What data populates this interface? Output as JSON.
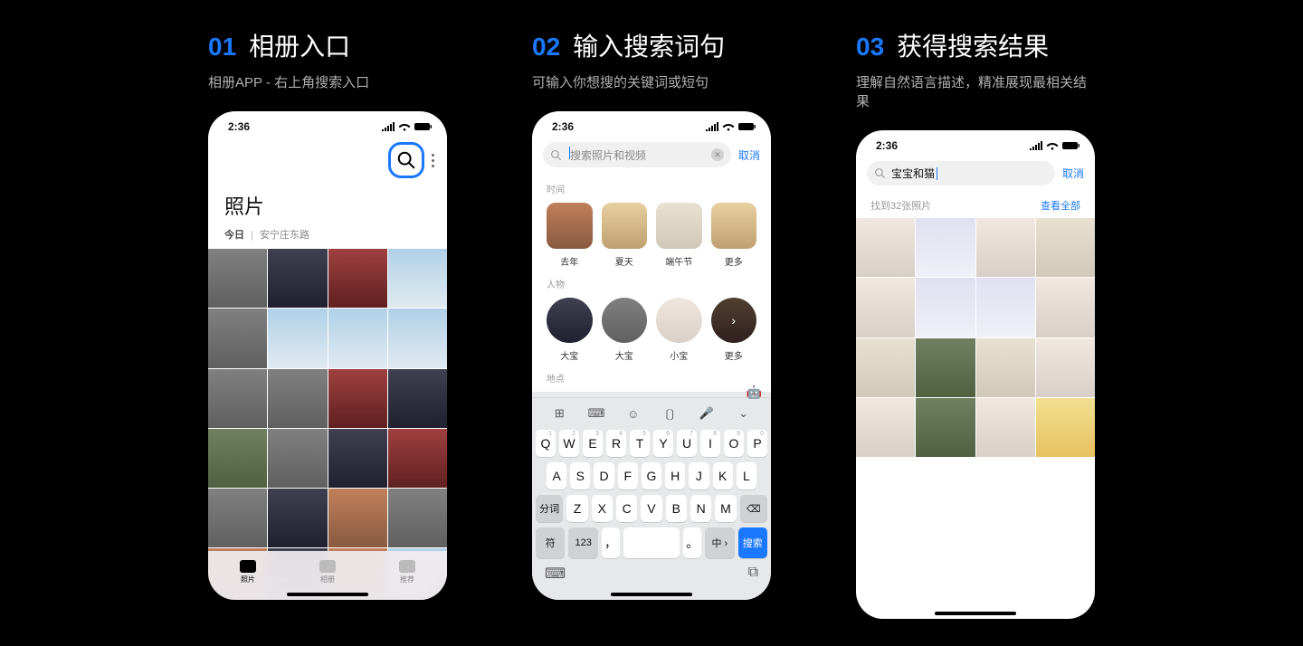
{
  "steps": [
    {
      "num": "01",
      "title": "相册入口",
      "desc": "相册APP - 右上角搜索入口"
    },
    {
      "num": "02",
      "title": "输入搜索词句",
      "desc": "可输入你想搜的关键词或短句"
    },
    {
      "num": "03",
      "title": "获得搜索结果",
      "desc": "理解自然语言描述，精准展现最相关结果"
    }
  ],
  "statusbar": {
    "time": "2:36"
  },
  "phone1": {
    "title": "照片",
    "today": "今日",
    "location": "安宁庄东路",
    "nav": [
      "照片",
      "相册",
      "推荐"
    ]
  },
  "phone2": {
    "search_placeholder": "搜索照片和视频",
    "cancel": "取消",
    "sections": {
      "time": {
        "label": "时间",
        "items": [
          "去年",
          "夏天",
          "端午节",
          "更多"
        ]
      },
      "people": {
        "label": "人物",
        "items": [
          "大宝",
          "大宝",
          "小宝",
          "更多"
        ]
      },
      "place": {
        "label": "地点"
      }
    },
    "keyboard": {
      "row1": [
        "Q",
        "W",
        "E",
        "R",
        "T",
        "Y",
        "U",
        "I",
        "O",
        "P"
      ],
      "row1sup": [
        "1",
        "2",
        "3",
        "4",
        "5",
        "6",
        "7",
        "8",
        "9",
        "0"
      ],
      "row2": [
        "A",
        "S",
        "D",
        "F",
        "G",
        "H",
        "J",
        "K",
        "L"
      ],
      "row3_lead": "分词",
      "row3": [
        "Z",
        "X",
        "C",
        "V",
        "B",
        "N",
        "M"
      ],
      "row3_trail": "⌫",
      "row4": [
        "符",
        "123",
        "，",
        "",
        "。",
        "中 ›",
        "搜索"
      ]
    }
  },
  "phone3": {
    "query": "宝宝和猫",
    "cancel": "取消",
    "results_label": "找到32张照片",
    "view_all": "查看全部"
  }
}
